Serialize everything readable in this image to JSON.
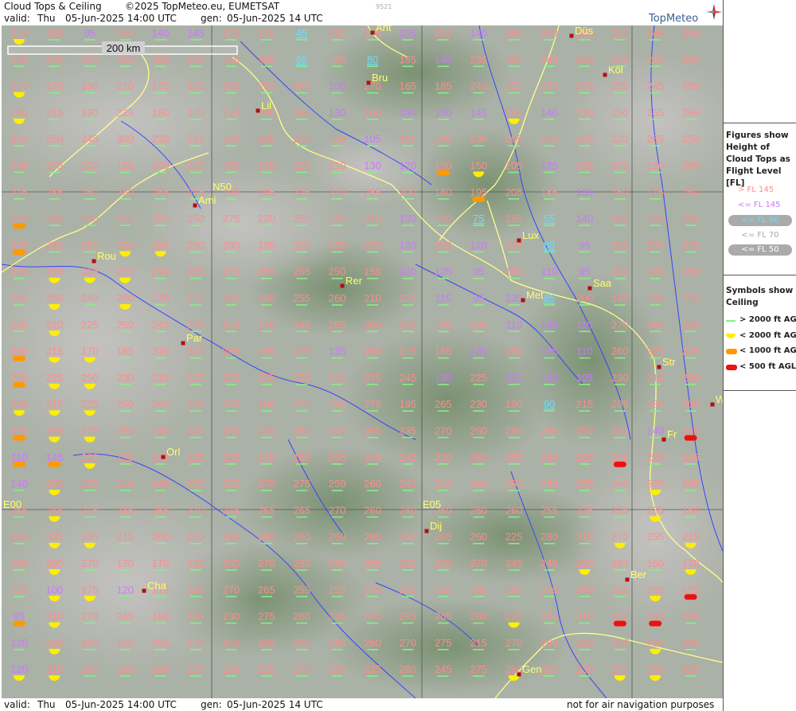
{
  "header": {
    "product": "Cloud Tops & Ceiling",
    "copyright": "©2025 TopMeteo.eu, EUMETSAT",
    "valid_label": "valid:",
    "valid_day": "Thu",
    "valid_time": "05-Jun-2025  14:00 UTC",
    "gen_label": "gen:",
    "gen_time": "05-Jun-2025 14 UTC",
    "image_code": "9521",
    "logo_text": "TopMeteo"
  },
  "footer": {
    "valid_label": "valid:",
    "valid_day": "Thu",
    "valid_time": "05-Jun-2025  14:00 UTC",
    "gen_label": "gen:",
    "gen_time": "05-Jun-2025 14 UTC",
    "disclaimer": "not for air navigation purposes"
  },
  "map": {
    "scale_label": "200 km",
    "grid_labels": {
      "lat": "N50",
      "lon_west": "E00",
      "lon_east": "E05"
    },
    "cities": [
      {
        "name": "Ant"
      },
      {
        "name": "Düs"
      },
      {
        "name": "Bru"
      },
      {
        "name": "Köl"
      },
      {
        "name": "Lil"
      },
      {
        "name": "Ami"
      },
      {
        "name": "Lux"
      },
      {
        "name": "Rou"
      },
      {
        "name": "Rer"
      },
      {
        "name": "Saa"
      },
      {
        "name": "Met"
      },
      {
        "name": "Par"
      },
      {
        "name": "Str"
      },
      {
        "name": "Fr"
      },
      {
        "name": "Orl"
      },
      {
        "name": "Dij"
      },
      {
        "name": "Ber"
      },
      {
        "name": "Cha"
      },
      {
        "name": "Gen"
      },
      {
        "name": "W"
      }
    ],
    "colors": {
      "high": "#ff8c8c",
      "mid": "#cc77ff",
      "low": "#66e0ff",
      "ceil_gt2000": "#88ee88",
      "ceil_lt2000": "#ffee00",
      "ceil_lt1000": "#ff9900",
      "ceil_lt500": "#ee1111",
      "city": "#ffff66",
      "border": "#ffff88",
      "river": "#3344ff"
    },
    "grid": [
      [
        "215",
        "185",
        "95",
        "155",
        "140",
        "145",
        "270",
        "170",
        "45",
        "220",
        "175",
        "105",
        "210",
        "140",
        "165",
        "260",
        "250",
        "250",
        "240",
        "250"
      ],
      [
        "150",
        "245",
        "225",
        "220",
        "200",
        "200",
        "150",
        "200",
        "65",
        "185",
        "80",
        "185",
        "145",
        "235",
        "160",
        "240",
        "260",
        "245",
        "255",
        "205"
      ],
      [
        "210",
        "220",
        "190",
        "210",
        "175",
        "160",
        "205",
        "215",
        "185",
        "100",
        "270",
        "165",
        "185",
        "240",
        "250",
        "225",
        "240",
        "255",
        "245",
        "250"
      ],
      [
        "185",
        "215",
        "190",
        "225",
        "180",
        "170",
        "150",
        "190",
        "185",
        "130",
        "160",
        "140",
        "130",
        "145",
        "250",
        "140",
        "230",
        "250",
        "255",
        "260"
      ],
      [
        "255",
        "250",
        "245",
        "300",
        "230",
        "215",
        "190",
        "180",
        "230",
        "155",
        "105",
        "155",
        "190",
        "235",
        "205",
        "155",
        "195",
        "220",
        "265",
        "250"
      ],
      [
        "240",
        "275",
        "300",
        "160",
        "245",
        "200",
        "185",
        "170",
        "190",
        "210",
        "130",
        "120",
        "150",
        "150",
        "205",
        "125",
        "195",
        "170",
        "190",
        "255"
      ],
      [
        "275",
        "285",
        "250",
        "260",
        "265",
        "215",
        "190",
        "195",
        "225",
        "210",
        "285",
        "200",
        "160",
        "195",
        "205",
        "185",
        "130",
        "150",
        "175",
        "250"
      ],
      [
        "230",
        "265",
        "290",
        "255",
        "285",
        "250",
        "275",
        "220",
        "250",
        "195",
        "215",
        "130",
        "150",
        "75",
        "195",
        "55",
        "140",
        "185",
        "205",
        "205"
      ],
      [
        "200",
        "260",
        "280",
        "220",
        "285",
        "290",
        "280",
        "195",
        "300",
        "230",
        "270",
        "130",
        "220",
        "120",
        "345",
        "80",
        "95",
        "195",
        "205",
        "275"
      ],
      [
        "295",
        "250",
        "285",
        "275",
        "270",
        "265",
        "275",
        "255",
        "265",
        "250",
        "150",
        "130",
        "125",
        "95",
        "185",
        "110",
        "95",
        "210",
        "165",
        "150"
      ],
      [
        "245",
        "250",
        "240",
        "280",
        "270",
        "270",
        "265",
        "240",
        "255",
        "260",
        "210",
        "225",
        "115",
        "95",
        "135",
        "85",
        "200",
        "185",
        "200",
        "275"
      ],
      [
        "245",
        "220",
        "225",
        "250",
        "245",
        "235",
        "210",
        "170",
        "245",
        "255",
        "250",
        "255",
        "165",
        "155",
        "110",
        "140",
        "110",
        "270",
        "260",
        "250"
      ],
      [
        "260",
        "215",
        "170",
        "185",
        "310",
        "300",
        "285",
        "195",
        "275",
        "135",
        "260",
        "275",
        "165",
        "135",
        "150",
        "135",
        "110",
        "260",
        "225",
        "225"
      ],
      [
        "255",
        "225",
        "250",
        "230",
        "210",
        "225",
        "270",
        "275",
        "225",
        "210",
        "275",
        "245",
        "135",
        "225",
        "130",
        "130",
        "105",
        "230",
        "215",
        "200"
      ],
      [
        "230",
        "215",
        "225",
        "250",
        "245",
        "235",
        "225",
        "150",
        "170",
        "260",
        "275",
        "195",
        "265",
        "230",
        "190",
        "90",
        "215",
        "205",
        "180",
        "200"
      ],
      [
        "235",
        "190",
        "275",
        "255",
        "210",
        "220",
        "230",
        "175",
        "160",
        "200",
        "265",
        "235",
        "270",
        "260",
        "260",
        "245",
        "250",
        "200",
        "140",
        "245"
      ],
      [
        "110",
        "145",
        "230",
        "195",
        "245",
        "225",
        "235",
        "170",
        "185",
        "265",
        "240",
        "245",
        "230",
        "260",
        "255",
        "240",
        "200",
        "205",
        "225",
        "215"
      ],
      [
        "140",
        "270",
        "205",
        "210",
        "220",
        "250",
        "220",
        "270",
        "275",
        "250",
        "260",
        "240",
        "210",
        "160",
        "250",
        "240",
        "205",
        "240",
        "335",
        "265"
      ],
      [
        "265",
        "245",
        "215",
        "245",
        "255",
        "270",
        "245",
        "265",
        "265",
        "270",
        "260",
        "260",
        "260",
        "260",
        "260",
        "255",
        "235",
        "235",
        "235",
        "160"
      ],
      [
        "205",
        "235",
        "255",
        "215",
        "200",
        "250",
        "260",
        "265",
        "260",
        "260",
        "260",
        "260",
        "265",
        "260",
        "225",
        "280",
        "215",
        "270",
        "255",
        "215"
      ],
      [
        "160",
        "200",
        "270",
        "170",
        "170",
        "210",
        "265",
        "270",
        "260",
        "250",
        "265",
        "260",
        "260",
        "270",
        "245",
        "245",
        "220",
        "180",
        "160",
        "170"
      ],
      [
        "155",
        "100",
        "175",
        "120",
        "175",
        "190",
        "270",
        "265",
        "255",
        "255",
        "270",
        "260",
        "260",
        "285",
        "265",
        "220",
        "200",
        "215",
        "200",
        "175"
      ],
      [
        "95",
        "210",
        "270",
        "265",
        "180",
        "190",
        "230",
        "275",
        "260",
        "245",
        "275",
        "285",
        "265",
        "280",
        "225",
        "255",
        "215",
        "220",
        "285",
        "250"
      ],
      [
        "120",
        "260",
        "185",
        "155",
        "255",
        "270",
        "250",
        "260",
        "255",
        "280",
        "260",
        "270",
        "275",
        "215",
        "270",
        "260",
        "220",
        "215",
        "250",
        "255"
      ],
      [
        "120",
        "215",
        "240",
        "195",
        "160",
        "235",
        "190",
        "225",
        "270",
        "265",
        "235",
        "280",
        "245",
        "275",
        "260",
        "305",
        "230",
        "230",
        "255",
        "315"
      ]
    ],
    "ceiling": [
      "ygggggggggggggggggg",
      "ggggggggggggggggggg",
      "ygggggggggggggggggg",
      "ygggggggggggggyggggg",
      "ggggggggggggggggggg",
      "ggggggggggggoyggggg",
      "gggggggggggggoggggg",
      "oggggggggggggggggggg",
      "oggyyggggggggggggggg",
      "gyyyggggggggggggggg",
      "gygyggggggggggggggg",
      "gygggggggggggggggggg",
      "oyyggggggggggggggggg",
      "oyyggggggggggggggggg",
      "yyyggggggggggggggggg",
      "oyyggggggggggggggggrg",
      "ooyggggggggggggggrgg",
      "gyggggggggggggggggyg",
      "gyggggggggggggggggyg",
      "gyyggggggggggggggygy",
      "gyggggggggggggggyggy",
      "gyygggggggggggggggyr",
      "oyggggggggggggyggrrg",
      "gyggggggggggggggggyg",
      "yyggggggggggggyggyyg"
    ]
  },
  "legend": {
    "tops_title": "Figures show Height of Cloud Tops as Flight Level  [FL]",
    "tops_rows": [
      {
        "text": "> FL 145",
        "color": "#ff8c8c"
      },
      {
        "text": "<= FL 145",
        "color": "#cc77ff"
      },
      {
        "text": "<= FL 90",
        "color": "#66e0ff"
      },
      {
        "text": "<= FL 70",
        "color": "#bbbbbb"
      },
      {
        "text": "<= FL 50",
        "color": "#ffffff"
      }
    ],
    "ceil_title": "Symbols show Ceiling",
    "ceil_rows": [
      {
        "text": "> 2000 ft AGL",
        "color": "#88ee88"
      },
      {
        "text": "< 2000 ft AGL",
        "color": "#ffee00"
      },
      {
        "text": "< 1000 ft AGL",
        "color": "#ff9900"
      },
      {
        "text": "< 500 ft AGL",
        "color": "#ee1111"
      }
    ]
  }
}
